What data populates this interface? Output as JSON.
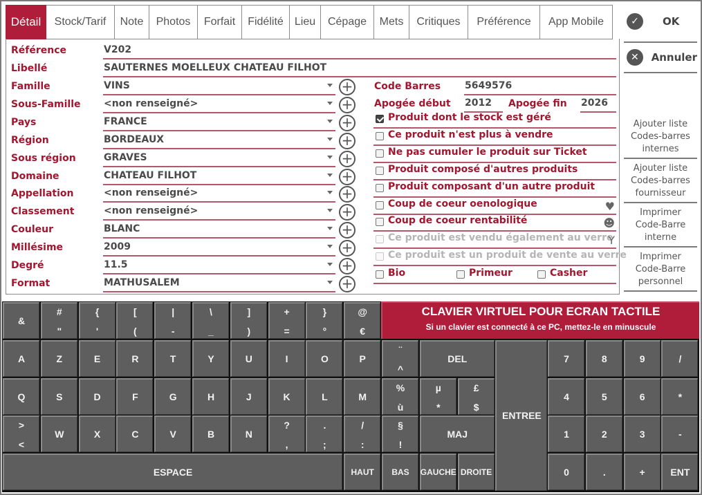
{
  "tabs": [
    "Détail",
    "Stock/Tarif",
    "Note",
    "Photos",
    "Forfait",
    "Fidélité",
    "Lieu",
    "Cépage",
    "Mets",
    "Critiques",
    "Préférence",
    "App Mobile"
  ],
  "active_tab": "Détail",
  "actions": {
    "ok": "OK",
    "cancel": "Annuler"
  },
  "side_buttons": [
    "Ajouter liste\nCodes-barres\ninternes",
    "Ajouter liste\nCodes-barres\nfournisseur",
    "Imprimer\nCode-Barre\ninterne",
    "Imprimer\nCode-Barre\npersonnel"
  ],
  "form": {
    "reference": {
      "label": "Référence",
      "value": "V202"
    },
    "libelle": {
      "label": "Libellé",
      "value": "SAUTERNES MOELLEUX CHATEAU FILHOT"
    },
    "selects": [
      {
        "label": "Famille",
        "value": "VINS"
      },
      {
        "label": "Sous-Famille",
        "value": "<non renseigné>"
      },
      {
        "label": "Pays",
        "value": "FRANCE"
      },
      {
        "label": "Région",
        "value": "BORDEAUX"
      },
      {
        "label": "Sous région",
        "value": "GRAVES"
      },
      {
        "label": "Domaine",
        "value": "CHATEAU FILHOT"
      },
      {
        "label": "Appellation",
        "value": "<non renseigné>"
      },
      {
        "label": "Classement",
        "value": "<non renseigné>"
      },
      {
        "label": "Couleur",
        "value": "BLANC"
      },
      {
        "label": "Millésime",
        "value": "2009"
      },
      {
        "label": "Degré",
        "value": "11.5"
      },
      {
        "label": "Format",
        "value": "MATHUSALEM"
      }
    ],
    "code_barres": {
      "label": "Code Barres",
      "value": "5649576"
    },
    "apogee_debut": {
      "label": "Apogée début",
      "value": "2012"
    },
    "apogee_fin": {
      "label": "Apogée fin",
      "value": "2026"
    },
    "checkboxes": [
      {
        "label": "Produit dont le stock est géré",
        "checked": true,
        "disabled": false,
        "icon": ""
      },
      {
        "label": "Ce produit n'est plus à vendre",
        "checked": false,
        "disabled": false,
        "icon": ""
      },
      {
        "label": "Ne pas cumuler le produit sur Ticket",
        "checked": false,
        "disabled": false,
        "icon": ""
      },
      {
        "label": "Produit composé d'autres produits",
        "checked": false,
        "disabled": false,
        "icon": ""
      },
      {
        "label": "Produit composant d'un autre produit",
        "checked": false,
        "disabled": false,
        "icon": ""
      },
      {
        "label": "Coup de coeur oenologique",
        "checked": false,
        "disabled": false,
        "icon": "heart-icon"
      },
      {
        "label": "Coup de coeur rentabilité",
        "checked": false,
        "disabled": false,
        "icon": "smiley-icon"
      },
      {
        "label": "Ce produit est vendu également au verre",
        "checked": false,
        "disabled": true,
        "icon": "glass-icon"
      },
      {
        "label": "Ce produit est un produit de vente au verre",
        "checked": false,
        "disabled": true,
        "icon": ""
      }
    ],
    "tags": [
      {
        "label": "Bio",
        "checked": false
      },
      {
        "label": "Primeur",
        "checked": false
      },
      {
        "label": "Casher",
        "checked": false
      }
    ]
  },
  "keyboard": {
    "banner_title": "CLAVIER VIRTUEL POUR ECRAN TACTILE",
    "banner_subtitle": "Si un clavier est connecté à ce PC, mettez-le en minuscule",
    "row1": [
      [
        "&",
        ""
      ],
      [
        "#",
        "\""
      ],
      [
        "{",
        "'"
      ],
      [
        "[",
        "("
      ],
      [
        "|",
        "-"
      ],
      [
        "\\",
        "_"
      ],
      [
        "]",
        ")"
      ],
      [
        "+",
        "="
      ],
      [
        "}",
        "°"
      ],
      [
        "@",
        "€"
      ]
    ],
    "row2": [
      "A",
      "Z",
      "E",
      "R",
      "T",
      "Y",
      "U",
      "I",
      "O",
      "P"
    ],
    "row2_extra": [
      "¨",
      "^"
    ],
    "row3": [
      "Q",
      "S",
      "D",
      "F",
      "G",
      "H",
      "J",
      "K",
      "L",
      "M"
    ],
    "row3_extra": [
      [
        "%",
        "ù"
      ],
      [
        "µ",
        "*"
      ],
      [
        "£",
        "$"
      ]
    ],
    "row4": [
      [
        ">",
        "<"
      ],
      [
        "",
        "W"
      ],
      [
        "",
        "X"
      ],
      [
        "",
        "C"
      ],
      [
        "",
        "V"
      ],
      [
        "",
        "B"
      ],
      [
        "",
        "N"
      ],
      [
        "?",
        ","
      ],
      [
        ".",
        ";"
      ],
      [
        "/",
        ":"
      ]
    ],
    "row4_extra": [
      "§",
      "!"
    ],
    "del": "DEL",
    "maj": "MAJ",
    "entree": "ENTREE",
    "espace": "ESPACE",
    "haut": "HAUT",
    "bas": "BAS",
    "gauche": "GAUCHE",
    "droite": "DROITE",
    "numpad": [
      [
        "7",
        "8",
        "9",
        "/"
      ],
      [
        "4",
        "5",
        "6",
        "*"
      ],
      [
        "1",
        "2",
        "3",
        "-"
      ],
      [
        "0",
        ".",
        "+",
        "ENT"
      ]
    ]
  },
  "colors": {
    "accent": "#b01d3a",
    "key_bg": "#5e5e5e",
    "label": "#a3162f"
  }
}
